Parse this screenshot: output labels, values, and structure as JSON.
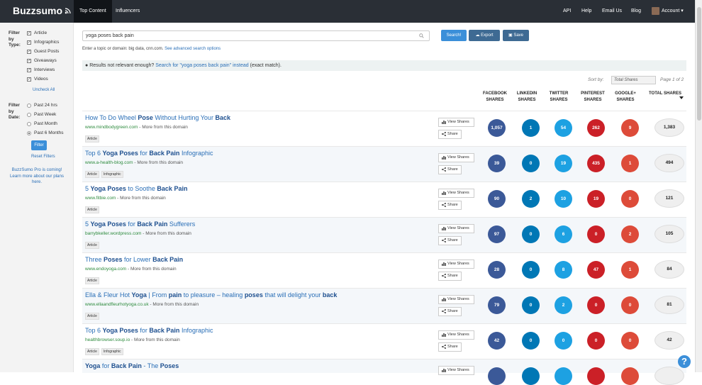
{
  "brand": {
    "name": "Buzzsumo"
  },
  "nav": {
    "tabs": [
      "Top Content",
      "Influencers"
    ],
    "right": [
      "API",
      "Help",
      "Email Us",
      "Blog"
    ],
    "account": "Account"
  },
  "sidebar": {
    "type_label": "Filter by Type:",
    "types": [
      {
        "label": "Article",
        "checked": true
      },
      {
        "label": "Infographics",
        "checked": true
      },
      {
        "label": "Guest Posts",
        "checked": true
      },
      {
        "label": "Giveaways",
        "checked": true
      },
      {
        "label": "Interviews",
        "checked": true
      },
      {
        "label": "Videos",
        "checked": true
      }
    ],
    "uncheck_all": "Uncheck All",
    "date_label": "Filter by Date:",
    "dates": [
      {
        "label": "Past 24 hrs",
        "selected": false
      },
      {
        "label": "Past Week",
        "selected": false
      },
      {
        "label": "Past Month",
        "selected": false
      },
      {
        "label": "Past 6 Months",
        "selected": true
      }
    ],
    "filter_button": "Filter",
    "reset": "Reset Filters",
    "promo": "BuzzSumo Pro is coming! Learn more about our plans here."
  },
  "search": {
    "value": "yoga poses back pain",
    "search_button": "Search!",
    "export_button": "Export",
    "save_button": "Save",
    "hint": "Enter a topic or domain: big data, cnn.com.",
    "hint_link": "See advanced search options"
  },
  "notice": {
    "text": "Results not relevant enough?",
    "link": "Search for \"yoga poses back pain\" instead",
    "suffix": "(exact match)."
  },
  "sort": {
    "label": "Sort by:",
    "value": "Total Shares",
    "page": "Page 1 of 2"
  },
  "columns": [
    "FACEBOOK SHARES",
    "LINKEDIN SHARES",
    "TWITTER SHARES",
    "PINTEREST SHARES",
    "GOOGLE+ SHARES",
    "TOTAL SHARES"
  ],
  "colors": {
    "facebook": "#3b5998",
    "linkedin": "#0077b5",
    "twitter": "#1da1e2",
    "pinterest": "#cb2027",
    "google": "#dd4b39",
    "accent": "#3b8fd9"
  },
  "actions": {
    "view_shares": "View Shares",
    "share": "Share",
    "more_from": "More from this domain"
  },
  "results": [
    {
      "title": [
        [
          "How To Do Wheel ",
          false
        ],
        [
          "Pose",
          true
        ],
        [
          " Without Hurting Your ",
          false
        ],
        [
          "Back",
          true
        ]
      ],
      "domain": "www.mindbodygreen.com",
      "tags": [
        "Article"
      ],
      "shares": [
        "1,057",
        "1",
        "54",
        "262",
        "9"
      ],
      "total": "1,383"
    },
    {
      "title": [
        [
          "Top 6 ",
          false
        ],
        [
          "Yoga Poses",
          true
        ],
        [
          " for ",
          false
        ],
        [
          "Back Pain",
          true
        ],
        [
          " Infographic",
          false
        ]
      ],
      "domain": "www.a-health-blog.com",
      "tags": [
        "Article",
        "Infographic"
      ],
      "shares": [
        "39",
        "0",
        "19",
        "435",
        "1"
      ],
      "total": "494"
    },
    {
      "title": [
        [
          "5 ",
          false
        ],
        [
          "Yoga Poses",
          true
        ],
        [
          " to Soothe ",
          false
        ],
        [
          "Back Pain",
          true
        ]
      ],
      "domain": "www.fitbie.com",
      "tags": [
        "Article"
      ],
      "shares": [
        "90",
        "2",
        "10",
        "19",
        "0"
      ],
      "total": "121"
    },
    {
      "title": [
        [
          "5 ",
          false
        ],
        [
          "Yoga Poses",
          true
        ],
        [
          " for ",
          false
        ],
        [
          "Back Pain",
          true
        ],
        [
          " Sufferers",
          false
        ]
      ],
      "domain": "barrybkeller.wordpress.com",
      "tags": [
        "Article"
      ],
      "shares": [
        "97",
        "0",
        "6",
        "0",
        "2"
      ],
      "total": "105"
    },
    {
      "title": [
        [
          "Three ",
          false
        ],
        [
          "Poses",
          true
        ],
        [
          " for Lower ",
          false
        ],
        [
          "Back Pain",
          true
        ]
      ],
      "domain": "www.endoyoga.com",
      "tags": [
        "Article"
      ],
      "shares": [
        "28",
        "0",
        "8",
        "47",
        "1"
      ],
      "total": "84"
    },
    {
      "title": [
        [
          "Ella & Fleur Hot ",
          false
        ],
        [
          "Yoga",
          true
        ],
        [
          " | From ",
          false
        ],
        [
          "pain",
          true
        ],
        [
          " to pleasure – healing ",
          false
        ],
        [
          "poses",
          true
        ],
        [
          " that will delight your ",
          false
        ],
        [
          "back",
          true
        ]
      ],
      "domain": "www.ellaandfleurhotyoga.co.uk",
      "tags": [
        "Article"
      ],
      "shares": [
        "79",
        "0",
        "2",
        "0",
        "0"
      ],
      "total": "81"
    },
    {
      "title": [
        [
          "Top 6 ",
          false
        ],
        [
          "Yoga Poses",
          true
        ],
        [
          " for ",
          false
        ],
        [
          "Back Pain",
          true
        ],
        [
          " Infographic",
          false
        ]
      ],
      "domain": "healthbrowser.soup.io",
      "tags": [
        "Article",
        "Infographic"
      ],
      "shares": [
        "42",
        "0",
        "0",
        "0",
        "0"
      ],
      "total": "42"
    },
    {
      "title": [
        [
          "Yoga",
          true
        ],
        [
          " for ",
          false
        ],
        [
          "Back Pain",
          true
        ],
        [
          " - The ",
          false
        ],
        [
          "Poses",
          true
        ]
      ],
      "domain": "",
      "tags": [],
      "shares": [
        "",
        "",
        "",
        "",
        ""
      ],
      "total": ""
    }
  ]
}
